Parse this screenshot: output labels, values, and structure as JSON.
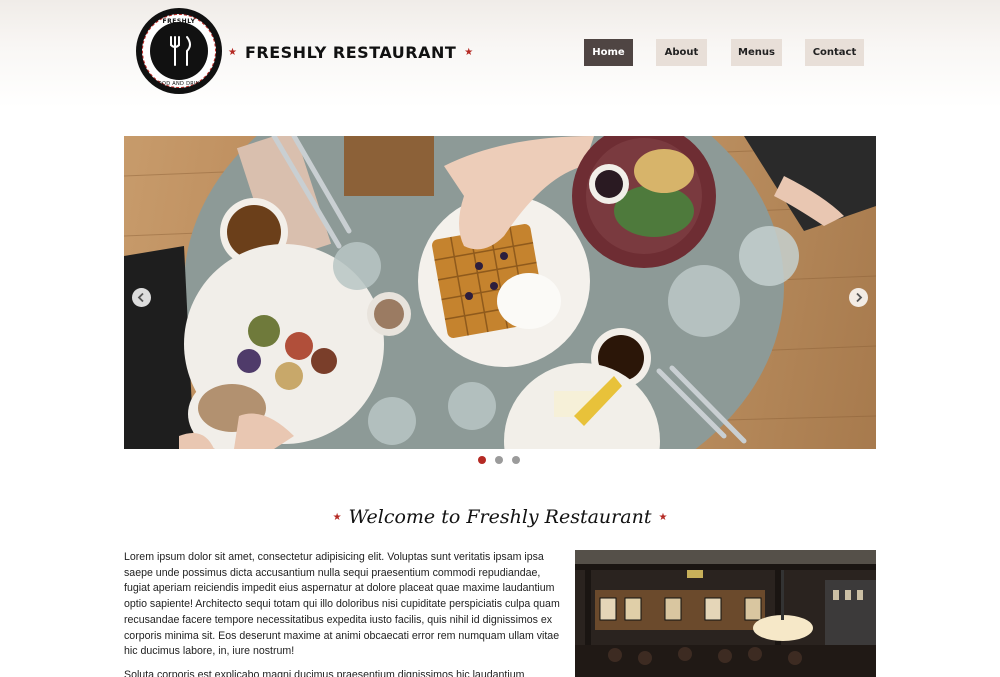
{
  "logo": {
    "top_text": "FRESHLY",
    "bottom_text": "FOOD AND DRINK"
  },
  "brand": {
    "name": "FRESHLY RESTAURANT",
    "star": "★"
  },
  "nav": {
    "items": [
      {
        "label": "Home",
        "active": true
      },
      {
        "label": "About",
        "active": false
      },
      {
        "label": "Menus",
        "active": false
      },
      {
        "label": "Contact",
        "active": false
      }
    ]
  },
  "slider": {
    "image_alt": "Overhead view of a restaurant table with waffles, coffee and breakfast plates",
    "prev_icon": "chevron-left-icon",
    "next_icon": "chevron-right-icon",
    "slide_count": 3,
    "active_slide": 1
  },
  "welcome": {
    "title": "Welcome to Freshly Restaurant",
    "star": "★"
  },
  "content": {
    "paragraph_1": "Lorem ipsum dolor sit amet, consectetur adipisicing elit. Voluptas sunt veritatis ipsam ipsa saepe unde possimus dicta accusantium nulla sequi praesentium commodi repudiandae, fugiat aperiam reiciendis impedit eius aspernatur at dolore placeat quae maxime laudantium optio sapiente! Architecto sequi totam qui illo doloribus nisi cupiditate perspiciatis culpa quam recusandae facere tempore necessitatibus expedita iusto facilis, quis nihil id dignissimos ex corporis minima sit. Eos deserunt maxime at animi obcaecati error rem numquam ullam vitae hic ducimus labore, in, iure nostrum!",
    "paragraph_2": "Soluta corporis est explicabo magni ducimus praesentium dignissimos hic laudantium accusantium",
    "interior_image_alt": "Restaurant interior with hanging lamps and framed pictures"
  },
  "colors": {
    "accent": "#b52a24",
    "nav_active": "#4f4543",
    "nav_inactive": "#e8dfd8"
  }
}
